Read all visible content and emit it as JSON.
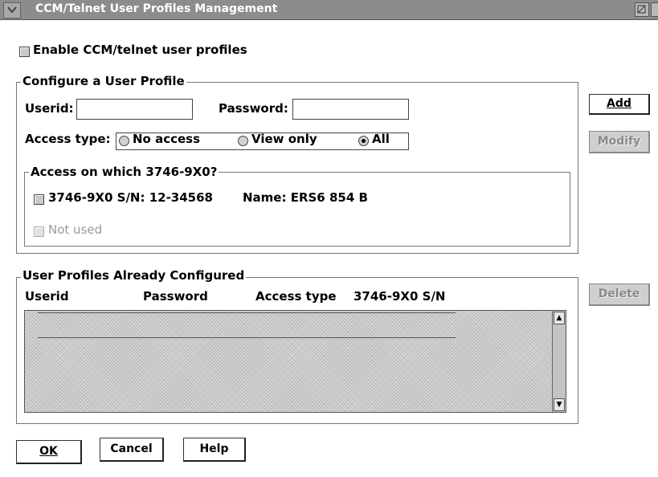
{
  "window": {
    "title": "CCM/Telnet User Profiles Management"
  },
  "enable": {
    "label": "Enable CCM/telnet user profiles"
  },
  "configure": {
    "legend": "Configure a User Profile",
    "userid_label": "Userid:",
    "userid_value": "",
    "password_label": "Password:",
    "password_value": "",
    "access_type_label": "Access type:",
    "radios": [
      {
        "label": "No access",
        "checked": false
      },
      {
        "label": "View only",
        "checked": false
      },
      {
        "label": "All",
        "checked": true
      }
    ]
  },
  "access_on": {
    "legend": "Access on which 3746-9X0?",
    "machine_label": "3746-9X0 S/N: 12-34568",
    "machine_name": "Name: ERS6 854 B",
    "not_used_label": "Not used"
  },
  "profiles": {
    "legend": "User Profiles Already Configured",
    "columns": [
      "Userid",
      "Password",
      "Access type",
      "3746-9X0 S/N"
    ],
    "rows": []
  },
  "buttons": {
    "add": "Add",
    "modify": "Modify",
    "delete": "Delete",
    "ok": "OK",
    "cancel": "Cancel",
    "help": "Help"
  },
  "icons": {
    "system_menu": "system-menu-icon",
    "minimize": "minimize-icon",
    "maximize": "maximize-icon",
    "scroll_up": "scroll-up-arrow-icon",
    "scroll_down": "scroll-down-arrow-icon"
  }
}
